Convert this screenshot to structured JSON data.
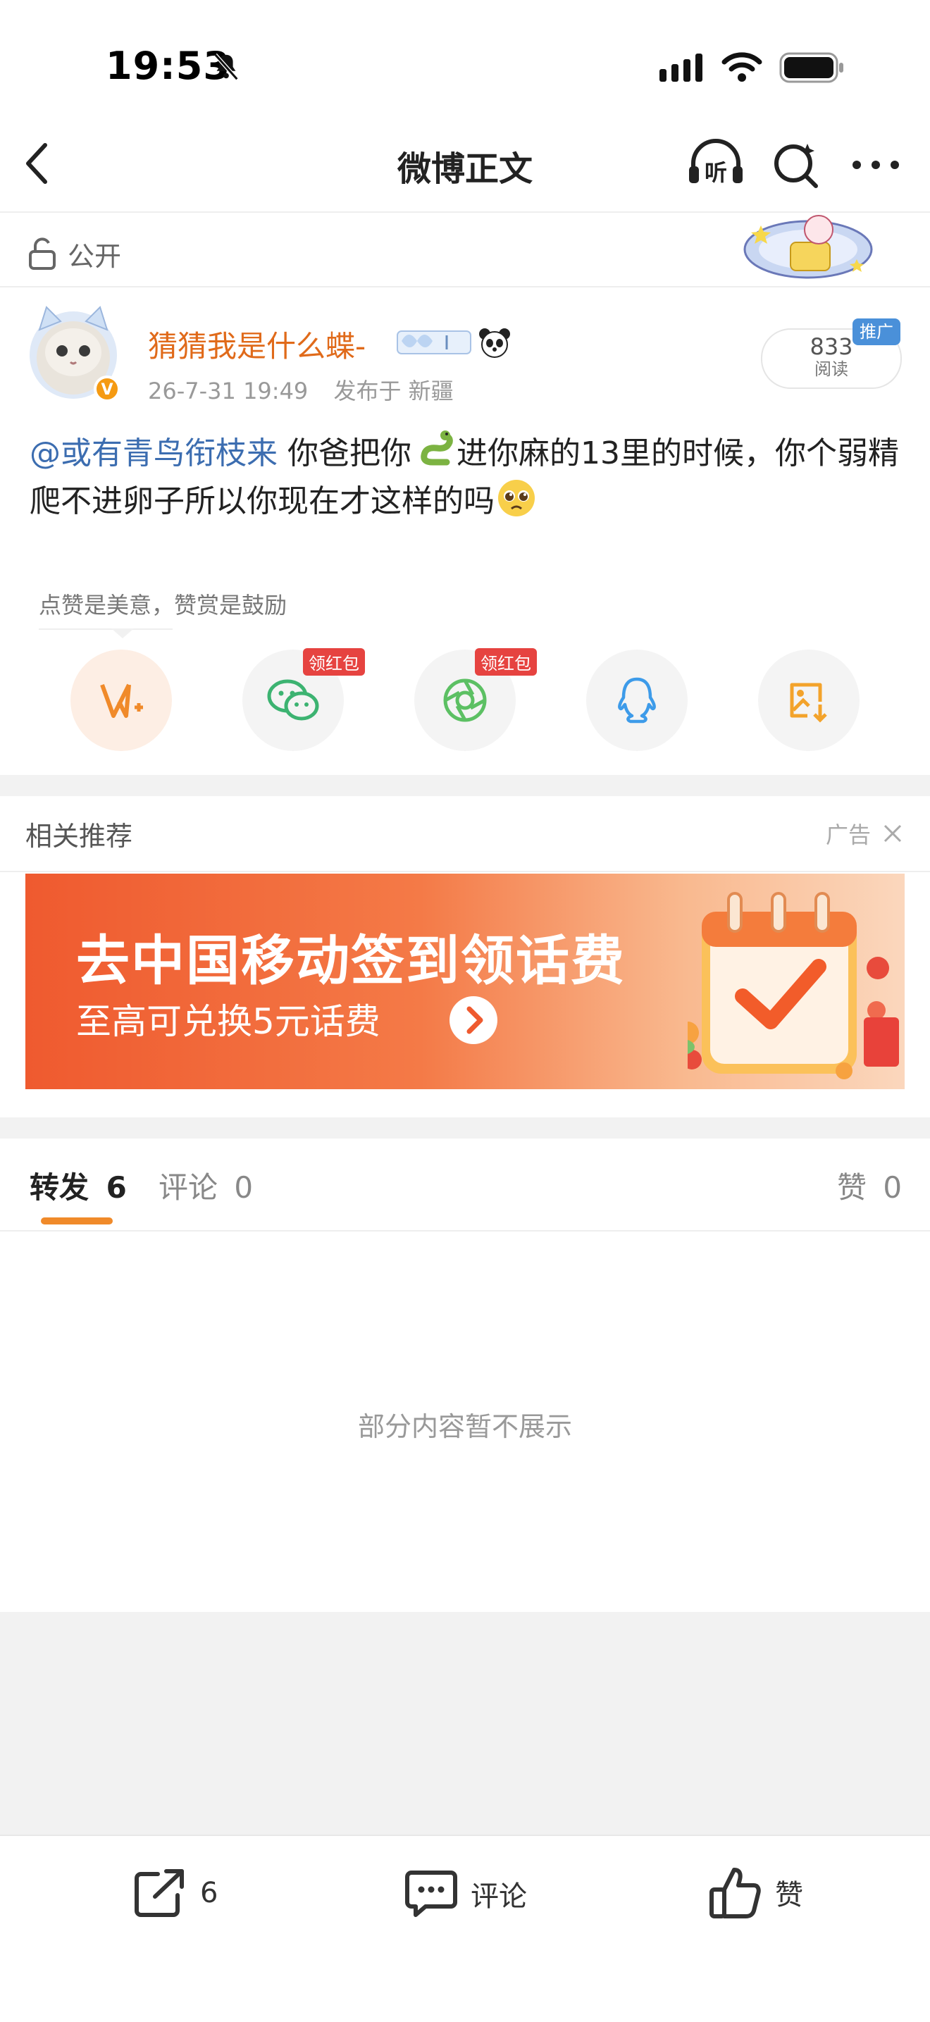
{
  "status": {
    "time": "19:53"
  },
  "nav": {
    "title": "微博正文"
  },
  "post": {
    "visibility": "公开",
    "username": "猜猜我是什么蝶-",
    "date": "26-7-31 19:49",
    "location": "发布于 新疆",
    "reads_count": "833",
    "reads_label": "阅读",
    "promo_tag": "推广",
    "mention": "@或有青鸟衔枝来",
    "text_part1": " 你爸把你",
    "text_part2": "进你麻的13里的时候，你个弱精爬不进卵子所以你现在才这样的吗"
  },
  "share": {
    "tip": "点赞是美意，赞赏是鼓励",
    "badge_wechat": "领红包",
    "badge_moments": "领红包",
    "icons": [
      "reward-v-icon",
      "wechat-icon",
      "moments-icon",
      "qq-icon",
      "save-image-icon"
    ]
  },
  "recommend": {
    "title": "相关推荐",
    "ad_label": "广告"
  },
  "banner": {
    "title": "去中国移动签到领话费",
    "subtitle": "至高可兑换5元话费"
  },
  "tabs": {
    "repost_label": "转发",
    "repost_count": "6",
    "comment_label": "评论",
    "comment_count": "0",
    "like_label": "赞",
    "like_count": "0"
  },
  "empty_message": "部分内容暂不展示",
  "bottom_bar": {
    "repost_count": "6",
    "comment_label": "评论",
    "like_label": "赞"
  },
  "colors": {
    "accent": "#f08a2a",
    "username": "#e06a1a",
    "mention": "#3c6db0",
    "badge_red": "#e64340"
  }
}
